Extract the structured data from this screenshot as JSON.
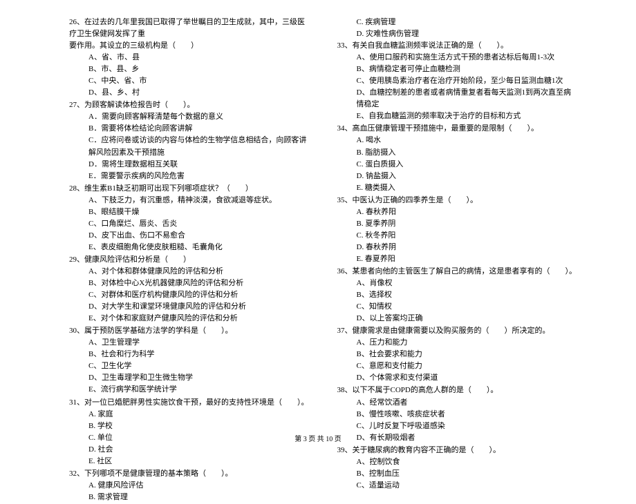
{
  "left": {
    "q26": {
      "text": "26、在过去的几年里我国已取得了举世瞩目的卫生成就，其中，三级医疗卫生保健网发挥了重",
      "text2": "要作用。其设立的三级机构是（　　）",
      "a": "A、省、市、县",
      "b": "B、市、县、乡",
      "c": "C、中央、省、市",
      "d": "D、县、乡、村"
    },
    "q27": {
      "text": "27、为顾客解读体检报告时（　　）。",
      "a": "A．需要向顾客解释清楚每个数据的意义",
      "b": "B．需要将体检结论向顾客讲解",
      "c": "C．应将问卷或访谈的内容与体检的生物学信息相结合，向顾客讲解风险因素及干预措施",
      "d": "D．需将生理数据相互关联",
      "e": "E．需要警示疾病的风险危害"
    },
    "q28": {
      "text": "28、维生素B1缺乏初期可出现下列哪项症状？（　　）",
      "a": "A、下肢乏力，有沉重感，精神淡漠，食欲减退等症状。",
      "b": "B、眼结膜干燥",
      "c": "C、口角糜烂、唇炎、舌炎",
      "d": "D、皮下出血、伤口不易愈合",
      "e": "E、表皮细胞角化使皮肤粗糙、毛囊角化"
    },
    "q29": {
      "text": "29、健康风险评估和分析是（　　）",
      "a": "A、对个体和群体健康风险的评估和分析",
      "b": "B、对体检中心X光机器健康风险的评估和分析",
      "c": "C、对群体和医疗机构健康风险的评估和分析",
      "d": "D、对大学生和课堂环境健康风险的评估和分析",
      "e": "E、对个体和家庭财产健康风险的评估和分析"
    },
    "q30": {
      "text": "30、属于预防医学基础方法学的学科是（　　）。",
      "a": "A、卫生管理学",
      "b": "B、社会和行为科学",
      "c": "C、卫生化学",
      "d": "D、卫生毒理学和卫生微生物学",
      "e": "E、流行病学和医学统计学"
    },
    "q31": {
      "text": "31、对一位已婚肥胖男性实施饮食干预，最好的支持性环境是（　　）。",
      "a": "A. 家庭",
      "b": "B. 学校",
      "c": "C. 单位",
      "d": "D. 社会",
      "e": "E. 社区"
    },
    "q32": {
      "text": "32、下列哪项不是健康管理的基本策略（　　）。",
      "a": "A. 健康风险评估",
      "b": "B. 需求管理"
    }
  },
  "right": {
    "q32c": "C. 疾病管理",
    "q32d": "D. 灾难性病伤管理",
    "q33": {
      "text": "33、有关自我血糖监测频率说法正确的是（　　）。",
      "a": "A、使用口服药和实施生活方式干预的患者达标后每周1-3次",
      "b": "B、病情稳定者可停止血糖检测",
      "c": "C、使用胰岛素治疗者在治疗开始阶段，至少每日监测血糖1次",
      "d": "D、血糖控制差的患者或者病情重复者看每天监测1到两次直至病情稳定",
      "e": "E、自我血糖监测的频率取决于治疗的目标和方式"
    },
    "q34": {
      "text": "34、高血压健康管理干预措施中，最重要的是限制（　　）。",
      "a": "A. 喝水",
      "b": "B. 脂肪摄入",
      "c": "C. 蛋白质摄入",
      "d": "D. 钠盐摄入",
      "e": "E. 糖类摄入"
    },
    "q35": {
      "text": "35、中医认为正确的四季养生是（　　）。",
      "a": "A. 春秋养阳",
      "b": "B. 夏季养阴",
      "c": "C. 秋冬养阳",
      "d": "D. 春秋养阴",
      "e": "E. 春夏养阳"
    },
    "q36": {
      "text": "36、某患者向他的主管医生了解自己的病情，这是患者享有的（　　）。",
      "a": "A、肖像权",
      "b": "B、选择权",
      "c": "C、知情权",
      "d": "D、以上答案均正确"
    },
    "q37": {
      "text": "37、健康需求是由健康需要以及购买服务的（　　）所决定的。",
      "a": "A、压力和能力",
      "b": "B、社会要求和能力",
      "c": "C、意愿和支付能力",
      "d": "D、个体需求和支付渠道"
    },
    "q38": {
      "text": "38、以下不属于COPD的高危人群的是（　　）。",
      "a": "A、经常饮酒者",
      "b": "B、慢性咳嗽、咳痰症状者",
      "c": "C、儿时反复下呼吸道感染",
      "d": "D、有长期吸烟者"
    },
    "q39": {
      "text": "39、关于糖尿病的教育内容不正确的是（　　）。",
      "a": "A、控制饮食",
      "b": "B、控制血压",
      "c": "C、适量运动"
    }
  },
  "footer": "第 3 页  共 10 页"
}
